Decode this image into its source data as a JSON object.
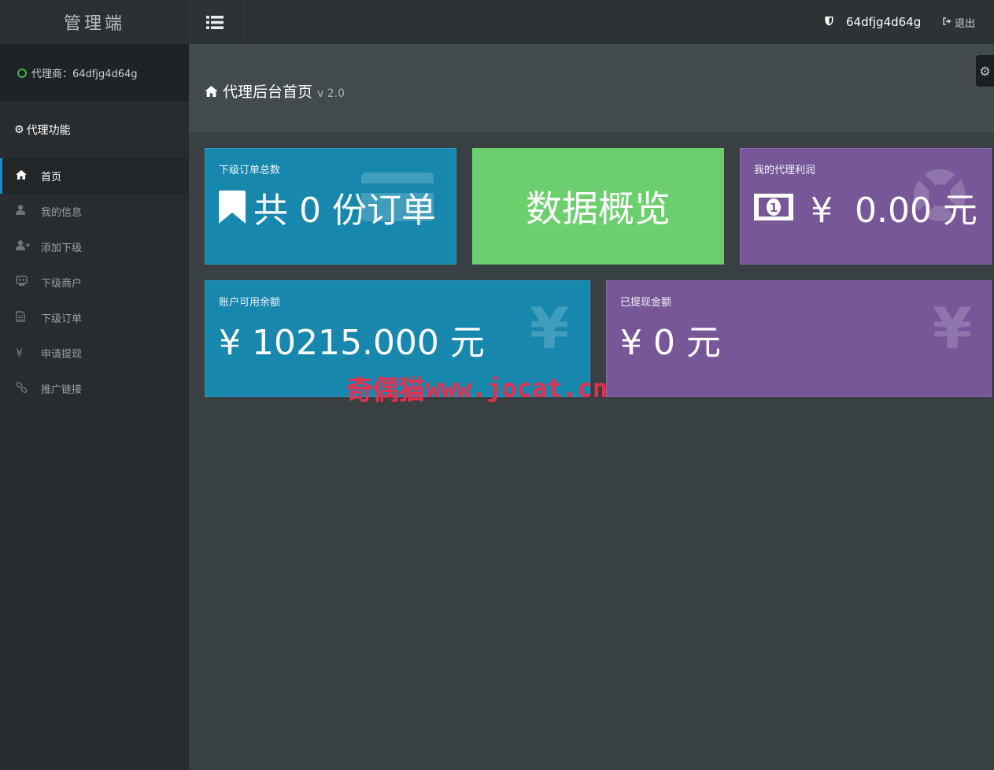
{
  "brand": {
    "title": "管理端"
  },
  "sidebar": {
    "agent_label": "代理商：64dfjg4d64g",
    "section_title": "代理功能",
    "items": [
      {
        "label": "首页",
        "icon": "home-icon"
      },
      {
        "label": "我的信息",
        "icon": "user-icon"
      },
      {
        "label": "添加下级",
        "icon": "user-plus-icon"
      },
      {
        "label": "下级商户",
        "icon": "merchant-icon"
      },
      {
        "label": "下级订单",
        "icon": "document-icon"
      },
      {
        "label": "申请提现",
        "icon": "yen-icon"
      },
      {
        "label": "推广链接",
        "icon": "link-icon"
      }
    ]
  },
  "topbar": {
    "username": "64dfjg4d64g",
    "logout_label": "退出"
  },
  "header": {
    "title": "代理后台首页",
    "version": "v 2.0"
  },
  "cards": {
    "orders": {
      "label": "下级订单总数",
      "value": "共 0 份订单"
    },
    "overview": {
      "label": "数据概览"
    },
    "profit": {
      "label": "我的代理利润",
      "value": "¥  0.00 元"
    },
    "balance": {
      "label": "账户可用余额",
      "value": "¥ 10215.000 元"
    },
    "withdrawn": {
      "label": "已提现金额",
      "value": "¥ 0 元"
    }
  },
  "watermark": {
    "cn": "奇偶猫",
    "url": "www.jocat.cn"
  },
  "colors": {
    "sidebar_bg": "#282c2f",
    "content_bg": "#394044",
    "header_bg": "#434a4e",
    "card_blue": "#1787ae",
    "card_green": "#6ccf6e",
    "card_purple": "#785799",
    "accent": "#1e8bc3",
    "watermark": "#e4304f"
  }
}
